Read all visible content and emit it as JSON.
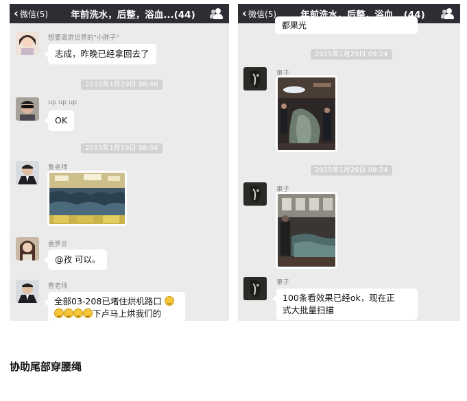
{
  "left_phone": {
    "back_label": "微信(5)",
    "title": "年前洗水，后整，浴血...(44)",
    "messages": [
      {
        "sender": "想要周游世界的\"小胖子\"",
        "text": "志成，昨晚已经拿回去了"
      },
      {
        "timestamp": "2015年1月29日 08:48"
      },
      {
        "sender": "up up up",
        "text": "OK"
      },
      {
        "timestamp": "2015年1月29日 08:56"
      },
      {
        "sender": "鲁老师",
        "image": "factory-photo"
      },
      {
        "sender": "香罗兰",
        "text": "@孜 可以。"
      },
      {
        "sender": "鲁老师",
        "text_line1": "全部03-208已堵住烘机路口",
        "text_line2": "下卢马上烘我们的"
      }
    ]
  },
  "right_phone": {
    "back_label": "微信(5)",
    "title": "年前洗水，后整，浴血...(44)",
    "cut_text": "都果光",
    "messages": [
      {
        "timestamp": "2015年1月29日 09:24"
      },
      {
        "sender": "果子",
        "image": "factory-photo"
      },
      {
        "timestamp": "2015年1月29日 09:24"
      },
      {
        "sender": "果子",
        "image": "factory-photo"
      },
      {
        "sender": "果子",
        "text_line1": "100条看效果已经ok，现在正",
        "text_line2": "式大批量扫描"
      }
    ]
  },
  "caption": "协助尾部穿腰绳",
  "colors": {
    "topbar": "#2c2e33",
    "chat_bg": "#ebebeb",
    "bubble": "#ffffff",
    "timestamp_bg": "#d2d2d2"
  },
  "icons": [
    "chevron-left-icon",
    "people-icon",
    "smile-emoji-icon"
  ]
}
